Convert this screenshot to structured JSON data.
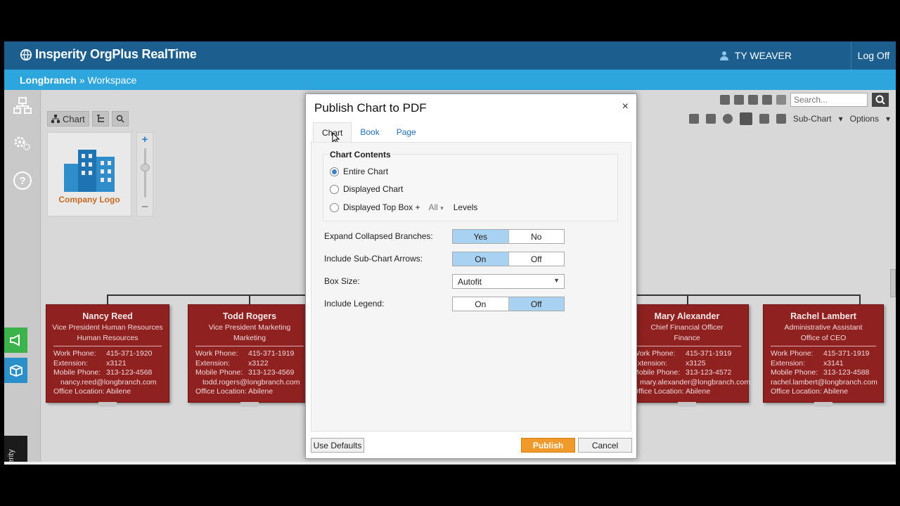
{
  "header": {
    "brand": "Insperity OrgPlus RealTime",
    "user": "TY WEAVER",
    "logoff": "Log Off"
  },
  "breadcrumb": {
    "root": "Longbranch",
    "sep": "»",
    "current": "Workspace"
  },
  "rail": {
    "brand_vertical": "© Insperity"
  },
  "workspace": {
    "chart_tab": "Chart",
    "logo_text": "Company Logo",
    "search_placeholder": "Search...",
    "subchart": "Sub-Chart",
    "options": "Options",
    "zoom_plus": "+",
    "zoom_minus": "–"
  },
  "cards": [
    {
      "name": "Nancy Reed",
      "title": "Vice President Human Resources",
      "dept": "Human Resources",
      "rows": [
        {
          "k": "Work Phone:",
          "v": "415-371-1920"
        },
        {
          "k": "Extension:",
          "v": "x3121"
        },
        {
          "k": "Mobile Phone:",
          "v": "313-123-4568"
        }
      ],
      "email": "nancy.reed@longbranch.com",
      "location_k": "Office Location:",
      "location_v": "Abilene"
    },
    {
      "name": "Todd Rogers",
      "title": "Vice President Marketing",
      "dept": "Marketing",
      "rows": [
        {
          "k": "Work Phone:",
          "v": "415-371-1919"
        },
        {
          "k": "Extension:",
          "v": "x3122"
        },
        {
          "k": "Mobile Phone:",
          "v": "313-123-4569"
        }
      ],
      "email": "todd.rogers@longbranch.com",
      "location_k": "Office Location:",
      "location_v": "Abilene"
    },
    {
      "name": "Mary Alexander",
      "title": "Chief Financial Officer",
      "dept": "Finance",
      "rows": [
        {
          "k": "Work Phone:",
          "v": "415-371-1919"
        },
        {
          "k": "Extension:",
          "v": "x3125"
        },
        {
          "k": "Mobile Phone:",
          "v": "313-123-4572"
        }
      ],
      "email": "mary.alexander@longbranch.com",
      "location_k": "Office Location:",
      "location_v": "Abilene"
    },
    {
      "name": "Rachel Lambert",
      "title": "Administrative Assistant",
      "dept": "Office of CEO",
      "rows": [
        {
          "k": "Work Phone:",
          "v": "415-371-1919"
        },
        {
          "k": "Extension:",
          "v": "x3141"
        },
        {
          "k": "Mobile Phone:",
          "v": "313-123-4588"
        }
      ],
      "email": "rachel.lambert@longbranch.com",
      "location_k": "Office Location:",
      "location_v": "Abilene"
    }
  ],
  "modal": {
    "title": "Publish Chart to PDF",
    "close": "×",
    "tabs": [
      "Chart",
      "Book",
      "Page"
    ],
    "active_tab": "Chart",
    "chart_contents_label": "Chart Contents",
    "radios": [
      {
        "label": "Entire Chart",
        "selected": true
      },
      {
        "label": "Displayed Chart",
        "selected": false
      },
      {
        "label": "Displayed Top Box +",
        "selected": false
      }
    ],
    "levels_value": "All",
    "levels_label": "Levels",
    "options": {
      "expand_label": "Expand Collapsed Branches:",
      "expand_yes": "Yes",
      "expand_no": "No",
      "expand_selected": "Yes",
      "arrows_label": "Include Sub-Chart Arrows:",
      "arrows_on": "On",
      "arrows_off": "Off",
      "arrows_selected": "On",
      "boxsize_label": "Box Size:",
      "boxsize_value": "Autofit",
      "legend_label": "Include Legend:",
      "legend_on": "On",
      "legend_off": "Off",
      "legend_selected": "Off"
    },
    "buttons": {
      "defaults": "Use Defaults",
      "publish": "Publish",
      "cancel": "Cancel"
    }
  },
  "colors": {
    "topbar": "#1c5f8e",
    "crumbbar": "#2da6de",
    "card": "#8f2121",
    "toggle_selected": "#a9d1f1",
    "publish": "#f09a2c"
  }
}
